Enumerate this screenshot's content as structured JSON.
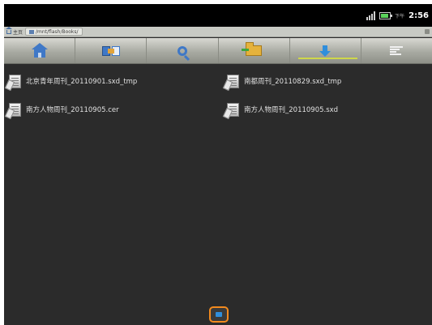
{
  "status_bar": {
    "ampm": "下午",
    "time": "2:56",
    "icons": [
      "signal-icon",
      "battery-icon"
    ],
    "battery_color": "#5bd15b"
  },
  "path_bar": {
    "home_label": "主页",
    "path": "/mnt/flash/Books/"
  },
  "toolbar": {
    "buttons": [
      {
        "icon": "home-icon"
      },
      {
        "icon": "switch-pane-icon"
      },
      {
        "icon": "search-icon"
      },
      {
        "icon": "new-folder-icon"
      },
      {
        "icon": "download-icon"
      },
      {
        "icon": "sort-icon"
      }
    ],
    "accent": "#3f78c7"
  },
  "files": [
    {
      "name": "北京青年周刊_20110901.sxd_tmp",
      "icon": "document-icon"
    },
    {
      "name": "南都周刊_20110829.sxd_tmp",
      "icon": "document-icon"
    },
    {
      "name": "南方人物周刊_20110905.cer",
      "icon": "document-icon"
    },
    {
      "name": "南方人物周刊_20110905.sxd",
      "icon": "document-icon"
    }
  ],
  "bottom_handle": {
    "icon": "menu-icon",
    "highlight_color": "#f28a1e"
  }
}
